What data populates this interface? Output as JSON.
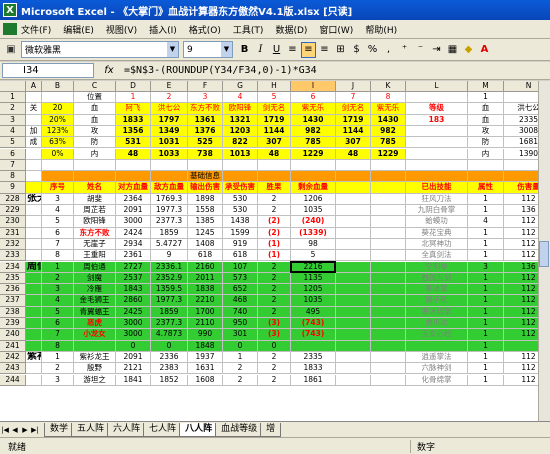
{
  "app": {
    "title": "Microsoft Excel - 《大掌门》血战计算器东方傲然V4.1版.xlsx  [只读]"
  },
  "menu": [
    "文件(F)",
    "编辑(E)",
    "视图(V)",
    "插入(I)",
    "格式(O)",
    "工具(T)",
    "数据(D)",
    "窗口(W)",
    "帮助(H)"
  ],
  "toolbar": {
    "font": "微软雅黑",
    "size": "9",
    "bold": "B",
    "italic": "I",
    "underline": "U"
  },
  "formula_bar": {
    "name_box": "I34",
    "fx": "fx",
    "formula": "=$N$3-(ROUNDUP(Y34/F34,0)-1)*G34"
  },
  "columns": [
    "A",
    "B",
    "C",
    "D",
    "E",
    "F",
    "G",
    "H",
    "I",
    "J",
    "K",
    "L",
    "M",
    "N"
  ],
  "rows": [
    {
      "n": "1",
      "c": {
        "C": "位置",
        "D": "1",
        "E": "2",
        "F": "3",
        "G": "4",
        "H": "5",
        "I": "6",
        "J": "7",
        "K": "8",
        "M": "1"
      }
    },
    {
      "n": "2",
      "c": {
        "A": "关",
        "B": "20",
        "C": "血",
        "D": "阿飞",
        "E": "洪七公",
        "F": "东方不败",
        "G": "欧阳锋",
        "H": "剑无名",
        "I": "紫无乐",
        "J": "剑无名",
        "K": "紫无乐",
        "L": "等级",
        "M": "血",
        "N": "洪七公"
      }
    },
    {
      "n": "3",
      "c": {
        "B": "20%",
        "C": "血",
        "D": "1833",
        "E": "1797",
        "F": "1361",
        "G": "1321",
        "H": "1719",
        "I": "1430",
        "J": "1719",
        "K": "1430",
        "L": "183",
        "M": "血",
        "N": "2335"
      }
    },
    {
      "n": "4",
      "c": {
        "A": "加",
        "B": "123%",
        "C": "攻",
        "D": "1356",
        "E": "1349",
        "F": "1376",
        "G": "1203",
        "H": "1144",
        "I": "982",
        "J": "1144",
        "K": "982",
        "M": "攻",
        "N": "3008"
      }
    },
    {
      "n": "5",
      "c": {
        "A": "成",
        "B": "63%",
        "C": "防",
        "D": "531",
        "E": "1031",
        "F": "525",
        "G": "822",
        "H": "307",
        "I": "785",
        "J": "307",
        "K": "785",
        "M": "防",
        "N": "1681"
      }
    },
    {
      "n": "6",
      "c": {
        "B": "0%",
        "C": "内",
        "D": "48",
        "E": "1033",
        "F": "738",
        "G": "1013",
        "H": "48",
        "I": "1229",
        "J": "48",
        "K": "1229",
        "M": "内",
        "N": "1390"
      }
    },
    {
      "n": "7",
      "c": {}
    },
    {
      "n": "8",
      "c": {
        "F": "基础信息"
      }
    },
    {
      "n": "9",
      "c": {
        "B": "序号",
        "C": "姓名",
        "D": "对方血量",
        "E": "敌方血量",
        "F": "输出伤害",
        "G": "承受伤害",
        "H": "胜果",
        "I": "剩余血量",
        "L": "已出技能",
        "M": "属性",
        "N": "伤害量"
      }
    },
    {
      "n": "228",
      "c": {
        "A": "张无忌",
        "B": "3",
        "C": "胡斐",
        "D": "2364",
        "E": "1769.3",
        "F": "1898",
        "G": "530",
        "H": "2",
        "I": "1206",
        "L": "狂风刀法",
        "M": "1",
        "N": "112"
      }
    },
    {
      "n": "229",
      "c": {
        "B": "4",
        "C": "周芷若",
        "D": "2091",
        "E": "1977.3",
        "F": "1558",
        "G": "530",
        "H": "2",
        "I": "1035",
        "L": "九阴白骨掌",
        "M": "1",
        "N": "136"
      }
    },
    {
      "n": "230",
      "c": {
        "B": "5",
        "C": "欧阳锋",
        "D": "3000",
        "E": "2377.3",
        "F": "1385",
        "G": "1438",
        "H": "(2)",
        "I": "(240)",
        "L": "蛤蟆功",
        "M": "4",
        "N": "112"
      }
    },
    {
      "n": "231",
      "c": {
        "B": "6",
        "C": "东方不败",
        "D": "2424",
        "E": "1859",
        "F": "1245",
        "G": "1599",
        "H": "(2)",
        "I": "(1339)",
        "L": "葵花宝典",
        "M": "1",
        "N": "112"
      }
    },
    {
      "n": "232",
      "c": {
        "B": "7",
        "C": "无崖子",
        "D": "2934",
        "E": "5.4727",
        "F": "1408",
        "G": "919",
        "H": "(1)",
        "I": "98",
        "L": "北冥神功",
        "M": "1",
        "N": "112"
      }
    },
    {
      "n": "233",
      "c": {
        "B": "8",
        "C": "王重阳",
        "D": "2361",
        "E": "9",
        "F": "618",
        "G": "618",
        "H": "(1)",
        "I": "5",
        "L": "全真剑法",
        "M": "1",
        "N": "112"
      }
    },
    {
      "n": "234",
      "c": {
        "A": "周伯通",
        "B": "1",
        "C": "周伯通",
        "D": "2727",
        "E": "2336.1",
        "F": "2160",
        "G": "107",
        "H": "2",
        "I": "2216",
        "L": "空明拳",
        "M": "3",
        "N": "136"
      }
    },
    {
      "n": "235",
      "c": {
        "B": "2",
        "C": "剑魔",
        "D": "2537",
        "E": "2352.9",
        "F": "2011",
        "G": "573",
        "H": "2",
        "I": "1135",
        "L": "独孤九剑",
        "M": "1",
        "N": "112"
      }
    },
    {
      "n": "236",
      "c": {
        "B": "3",
        "C": "冷雁",
        "D": "1843",
        "E": "1359.5",
        "F": "1838",
        "G": "652",
        "H": "2",
        "I": "1205",
        "L": "寒冰掌",
        "M": "1",
        "N": "112"
      }
    },
    {
      "n": "237",
      "c": {
        "B": "4",
        "C": "金毛狮王",
        "D": "2860",
        "E": "1977.3",
        "F": "2210",
        "G": "468",
        "H": "2",
        "I": "1035",
        "L": "狮子吼",
        "M": "1",
        "N": "112"
      }
    },
    {
      "n": "238",
      "c": {
        "B": "5",
        "C": "青翼蝠王",
        "D": "2425",
        "E": "1859",
        "F": "1700",
        "G": "740",
        "H": "2",
        "I": "495",
        "L": "寒冰绵掌",
        "M": "1",
        "N": "112"
      }
    },
    {
      "n": "239",
      "c": {
        "B": "6",
        "C": "恶虎",
        "D": "3000",
        "E": "2377.3",
        "F": "2110",
        "G": "950",
        "H": "(3)",
        "I": "(743)",
        "L": "虎爪功",
        "M": "1",
        "N": "112"
      }
    },
    {
      "n": "240",
      "c": {
        "B": "7",
        "C": "小龙女",
        "D": "3000",
        "E": "4.7873",
        "F": "990",
        "G": "301",
        "H": "(3)",
        "I": "(743)",
        "L": "玉女心经",
        "M": "1",
        "N": "112"
      }
    },
    {
      "n": "241",
      "c": {
        "B": "8",
        "D": "0",
        "E": "0",
        "F": "1848",
        "G": "0",
        "H": "0",
        "I": "",
        "L": "",
        "M": "1",
        "N": ""
      }
    },
    {
      "n": "242",
      "c": {
        "A": "紫衫",
        "B": "1",
        "C": "紫衫龙王",
        "D": "2091",
        "E": "2336",
        "F": "1937",
        "G": "1",
        "H": "2",
        "I": "2335",
        "L": "逍遥掌法",
        "M": "1",
        "N": "112"
      }
    },
    {
      "n": "243",
      "c": {
        "B": "2",
        "C": "殷野",
        "D": "2121",
        "E": "2383",
        "F": "1631",
        "G": "2",
        "H": "2",
        "I": "1833",
        "L": "六脉神剑",
        "M": "1",
        "N": "112"
      }
    },
    {
      "n": "244",
      "c": {
        "B": "3",
        "C": "游坦之",
        "D": "1841",
        "E": "1852",
        "F": "1608",
        "G": "2",
        "H": "2",
        "I": "1861",
        "L": "化骨绵掌",
        "M": "1",
        "N": "112"
      }
    }
  ],
  "tabs": [
    "数学",
    "五人阵",
    "六人阵",
    "七人阵",
    "八人阵",
    "血战等级",
    "增"
  ],
  "status": {
    "left": "就绪",
    "mode": "数字"
  },
  "colors": {
    "yellow": "#ffff00",
    "green": "#33cc33",
    "red": "#ff0000",
    "orange": "#ff9900",
    "header_sel": "#ffc869"
  }
}
